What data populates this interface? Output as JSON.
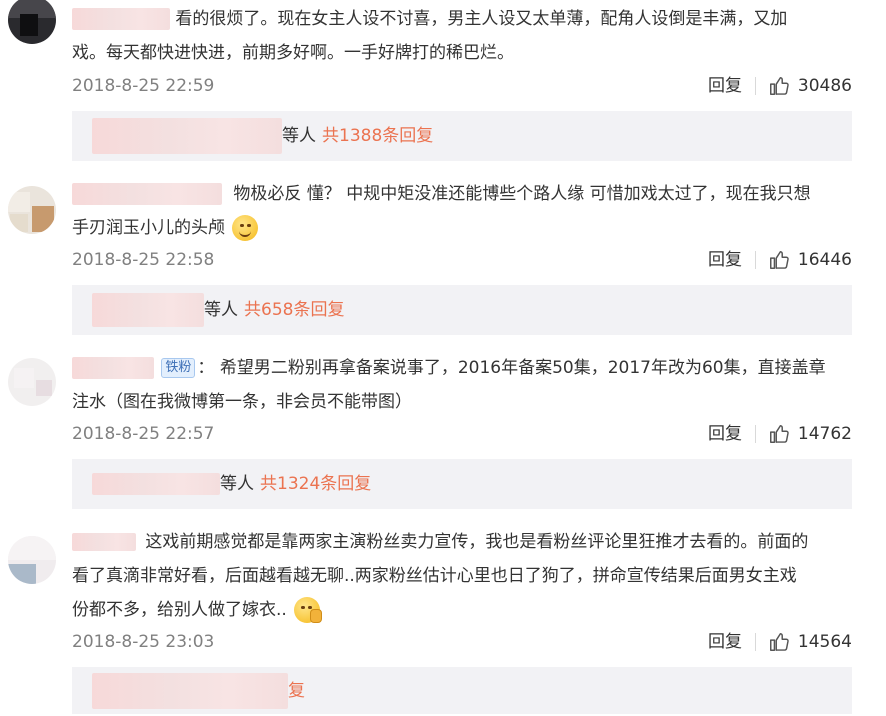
{
  "comments": [
    {
      "text_line1": "看的很烦了。现在女主人设不讨喜，男主人设又太单薄，配角人设倒是丰满，又加",
      "text_line2": "戏。每天都快进快进，前期多好啊。一手好牌打的稀巴烂。",
      "time": "2018-8-25 22:59",
      "reply_label": "回复",
      "likes": "30486",
      "sub_suffix": "等人",
      "sub_more": "共1388条回复"
    },
    {
      "text_line1": "物极必反 懂？ 中规中矩没准还能博些个路人缘 可惜加戏太过了，现在我只想",
      "text_line2": "手刃润玉小儿的头颅",
      "time": "2018-8-25 22:58",
      "reply_label": "回复",
      "likes": "16446",
      "sub_suffix": "等人",
      "sub_more": "共658条回复"
    },
    {
      "badge": "铁粉",
      "text_line1": "希望男二粉别再拿备案说事了，2016年备案50集，2017年改为60集，直接盖章",
      "text_line2": "注水（图在我微博第一条，非会员不能带图）",
      "time": "2018-8-25 22:57",
      "reply_label": "回复",
      "likes": "14762",
      "sub_suffix": "等人",
      "sub_more": "共1324条回复"
    },
    {
      "text_line1": "这戏前期感觉都是靠两家主演粉丝卖力宣传，我也是看粉丝评论里狂推才去看的。前面的",
      "text_line2": "看了真滴非常好看，后面越看越无聊..两家粉丝估计心里也日了狗了，拼命宣传结果后面男女主戏",
      "text_line3": "份都不多，给别人做了嫁衣..",
      "time": "2018-8-25 23:03",
      "reply_label": "回复",
      "likes": "14564",
      "sub_more_tail": "复"
    }
  ],
  "icons": {
    "like": "thumbs-up-icon",
    "emoji_smile": "smile-emoji-icon",
    "emoji_shush": "shush-emoji-icon"
  },
  "colors": {
    "link_orange": "#eb7350",
    "meta_gray": "#808080",
    "sub_bg": "#f2f2f5"
  }
}
